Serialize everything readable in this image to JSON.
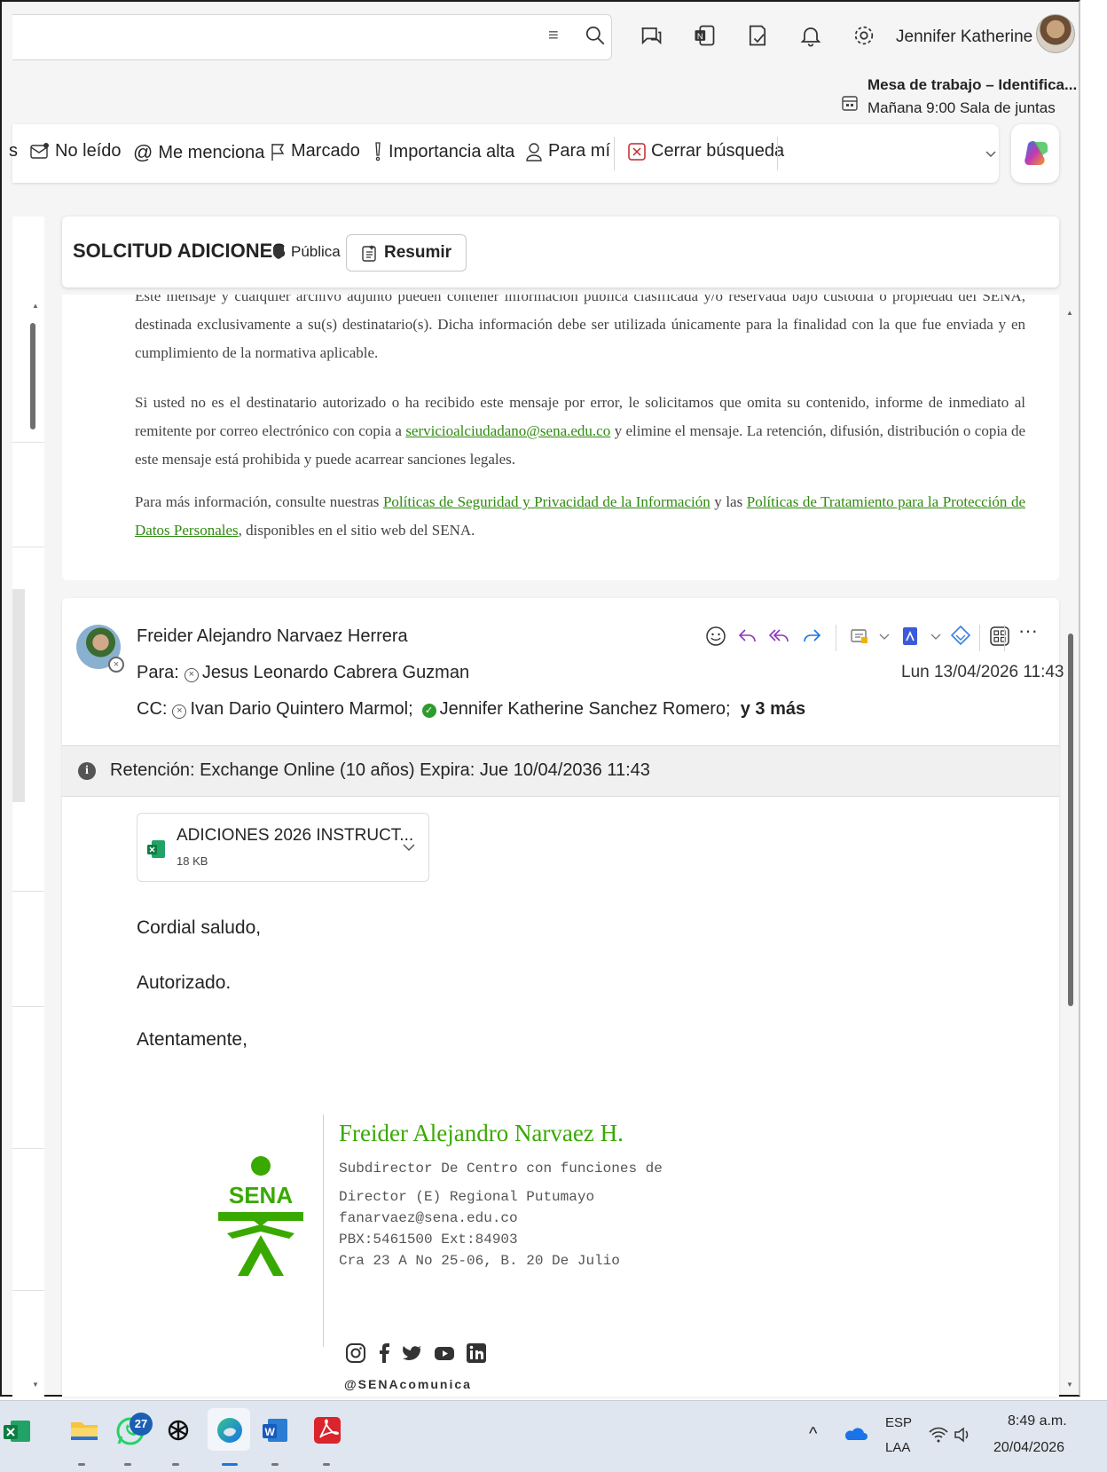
{
  "topbar": {
    "user_name": "Jennifer Katherine ...",
    "meeting_title": "Mesa de trabajo – Identifica...",
    "meeting_sub": "Mañana 9:00 Sala de juntas"
  },
  "filters": {
    "unread": "No leído",
    "mentions": "Me menciona",
    "flagged": "Marcado",
    "important": "Importancia alta",
    "to_me": "Para mí",
    "close_search": "Cerrar búsqueda"
  },
  "thread": {
    "subject": "SOLCITUD ADICIONES",
    "privacy": "Pública",
    "summarize": "Resumir"
  },
  "message1": {
    "p0": "Este mensaje y cualquier archivo adjunto pueden contener información pública clasificada y/o reservada bajo custodia o propiedad del SENA, destinada exclusivamente a su(s) destinatario(s). Dicha información debe ser utilizada únicamente para la finalidad con la que fue enviada y en cumplimiento de la normativa aplicable.",
    "p1_a": "Si usted no es el destinatario autorizado o ha recibido este mensaje por error, le solicitamos que omita su contenido, informe de inmediato al remitente por correo electrónico con copia a ",
    "p1_link": "servicioalciudadano@sena.edu.co",
    "p1_b": " y elimine el mensaje. La retención, difusión, distribución o copia de este mensaje está prohibida y puede acarrear sanciones legales.",
    "p2_a": "Para más información, consulte nuestras ",
    "p2_link1": "Políticas de Seguridad y Privacidad de la Información",
    "p2_b": " y las ",
    "p2_link2": "Políticas de Tratamiento para la Protección de Datos Personales",
    "p2_c": ", disponibles en el sitio web del SENA."
  },
  "message2": {
    "sender": "Freider Alejandro Narvaez Herrera",
    "to_label": "Para:",
    "to_name": "Jesus Leonardo Cabrera Guzman",
    "cc_label": "CC:",
    "cc_name1": "Ivan Dario Quintero Marmol;",
    "cc_name2": "Jennifer Katherine Sanchez Romero;",
    "cc_more": "y 3 más",
    "date": "Lun 13/04/2026 11:43",
    "retention": "Retención: Exchange Online (10 años) Expira: Jue 10/04/2036 11:43",
    "attachment_name": "ADICIONES 2026 INSTRUCT...",
    "attachment_size": "18 KB",
    "greeting": "Cordial saludo,",
    "body": "Autorizado.",
    "closing": "Atentamente,",
    "signature": {
      "name": "Freider Alejandro Narvaez H.",
      "line1": "Subdirector De Centro con funciones de",
      "line2": "Director (E) Regional Putumayo",
      "email": "fanarvaez@sena.edu.co",
      "phone": "PBX:5461500 Ext:84903",
      "address": "Cra 23 A No 25-06, B. 20 De Julio",
      "logo_text": "SENA",
      "handle": "@SENAcomunica"
    }
  },
  "taskbar": {
    "badge_count": "27",
    "lang1": "ESP",
    "lang2": "LAA",
    "time": "8:49 a.m.",
    "date": "20/04/2026"
  },
  "colors": {
    "sena_green": "#39a900",
    "link_green": "#2f8a0f",
    "accent_blue": "#1a73e8"
  }
}
